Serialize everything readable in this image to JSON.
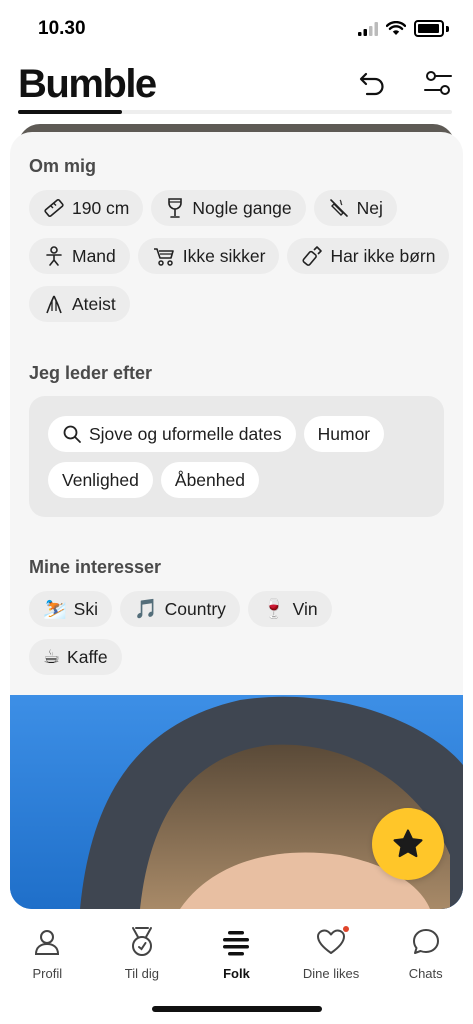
{
  "status_bar": {
    "time": "10.30"
  },
  "header": {
    "logo": "Bumble",
    "profile_progress": 0.24
  },
  "about": {
    "title": "Om mig",
    "rows": [
      [
        {
          "icon": "ruler-icon",
          "label": "190 cm"
        },
        {
          "icon": "wine-glass-icon",
          "label": "Nogle gange"
        },
        {
          "icon": "no-smoking-icon",
          "label": "Nej"
        }
      ],
      [
        {
          "icon": "person-icon",
          "label": "Mand"
        },
        {
          "icon": "stroller-icon",
          "label": "Ikke sikker"
        },
        {
          "icon": "baby-bottle-icon",
          "label": "Har ikke børn"
        }
      ],
      [
        {
          "icon": "hands-icon",
          "label": "Ateist"
        }
      ]
    ]
  },
  "looking_for": {
    "title": "Jeg leder efter",
    "items": [
      "Sjove og uformelle dates",
      "Humor",
      "Venlighed",
      "Åbenhed"
    ]
  },
  "interests": {
    "title": "Mine interesser",
    "items": [
      {
        "emoji": "⛷️",
        "label": "Ski"
      },
      {
        "emoji": "🎵",
        "label": "Country"
      },
      {
        "emoji": "🍷",
        "label": "Vin"
      },
      {
        "emoji": "☕",
        "label": "Kaffe"
      }
    ]
  },
  "nav": {
    "items": [
      {
        "icon": "profile-icon",
        "label": "Profil"
      },
      {
        "icon": "medal-icon",
        "label": "Til dig"
      },
      {
        "icon": "stack-icon",
        "label": "Folk"
      },
      {
        "icon": "heart-icon",
        "label": "Dine likes"
      },
      {
        "icon": "chat-bubble-icon",
        "label": "Chats"
      }
    ],
    "active": "Folk"
  },
  "colors": {
    "accent": "#ffc629",
    "chip_bg": "#ececec",
    "card_bg": "#f6f6f6",
    "notification": "#e0452b"
  }
}
